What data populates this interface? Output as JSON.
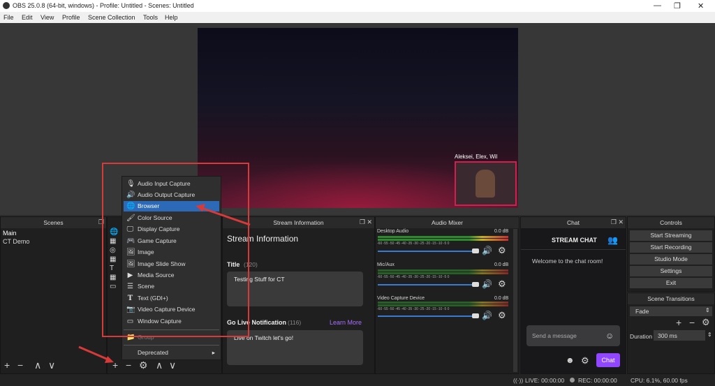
{
  "window": {
    "title": "OBS 25.0.8 (64-bit, windows) - Profile: Untitled - Scenes: Untitled",
    "minimize": "—",
    "maximize": "❐",
    "close": "✕"
  },
  "menubar": [
    "File",
    "Edit",
    "View",
    "Profile",
    "Scene Collection",
    "Tools",
    "Help"
  ],
  "preview": {
    "overlay_text": "Aleksei, Elex, Wil"
  },
  "scenes": {
    "title": "Scenes",
    "items": [
      "Main",
      "CT Demo"
    ],
    "controls": [
      "+",
      "−",
      "∧",
      "∨"
    ]
  },
  "sources": {
    "controls": [
      "+",
      "−",
      "⚙",
      "∧",
      "∨"
    ]
  },
  "context_menu": {
    "items": [
      {
        "label": "Audio Input Capture",
        "icon": "microphone-icon",
        "glyph": "🎙"
      },
      {
        "label": "Audio Output Capture",
        "icon": "speaker-icon",
        "glyph": "🔊"
      },
      {
        "label": "Browser",
        "icon": "globe-icon",
        "glyph": "🌐"
      },
      {
        "label": "Color Source",
        "icon": "brush-icon",
        "glyph": "🖌"
      },
      {
        "label": "Display Capture",
        "icon": "monitor-icon",
        "glyph": "🖵"
      },
      {
        "label": "Game Capture",
        "icon": "gamepad-icon",
        "glyph": "🎮"
      },
      {
        "label": "Image",
        "icon": "image-icon",
        "glyph": "🖼"
      },
      {
        "label": "Image Slide Show",
        "icon": "slideshow-icon",
        "glyph": "🖼"
      },
      {
        "label": "Media Source",
        "icon": "play-icon",
        "glyph": "▶"
      },
      {
        "label": "Scene",
        "icon": "list-icon",
        "glyph": "☰"
      },
      {
        "label": "Text (GDI+)",
        "icon": "text-icon",
        "glyph": "T"
      },
      {
        "label": "Video Capture Device",
        "icon": "camera-icon",
        "glyph": "📷"
      },
      {
        "label": "Window Capture",
        "icon": "window-icon",
        "glyph": "▭"
      },
      {
        "label": "Group",
        "icon": "folder-icon",
        "glyph": "📁"
      },
      {
        "label": "Deprecated",
        "icon": "",
        "glyph": ""
      }
    ],
    "selected": "Browser",
    "submenu_arrow": "▸"
  },
  "stream_info": {
    "header": "Stream Information",
    "heading": "Stream Information",
    "title_label": "Title",
    "title_count": "(120)",
    "title_value": "Testing Stuff for CT",
    "golive_label": "Go Live Notification",
    "golive_count": "(116)",
    "learn_more": "Learn More",
    "golive_value": "Live on Twitch let's go!"
  },
  "audio_mixer": {
    "title": "Audio Mixer",
    "channels": [
      {
        "name": "Desktop Audio",
        "db": "0.0 dB"
      },
      {
        "name": "Mic/Aux",
        "db": "0.0 dB"
      },
      {
        "name": "Video Capture Device",
        "db": "0.0 dB"
      }
    ],
    "scale": "-60 -55 -50 -45 -40 -35 -30 -25 -20 -15 -10 -5 0"
  },
  "chat": {
    "header": "Chat",
    "title": "STREAM CHAT",
    "welcome": "Welcome to the chat room!",
    "placeholder": "Send a message",
    "button": "Chat"
  },
  "controls": {
    "title": "Controls",
    "buttons": [
      "Start Streaming",
      "Start Recording",
      "Studio Mode",
      "Settings",
      "Exit"
    ]
  },
  "scene_transitions": {
    "title": "Scene Transitions",
    "selected": "Fade",
    "duration_label": "Duration",
    "duration_value": "300 ms"
  },
  "status": {
    "live": "LIVE: 00:00:00",
    "rec": "REC: 00:00:00",
    "cpu": "CPU: 6.1%, 60.00 fps"
  },
  "colors": {
    "accent": "#2c6ab8",
    "twitch": "#9147ff",
    "annotation": "#d83a3a"
  }
}
